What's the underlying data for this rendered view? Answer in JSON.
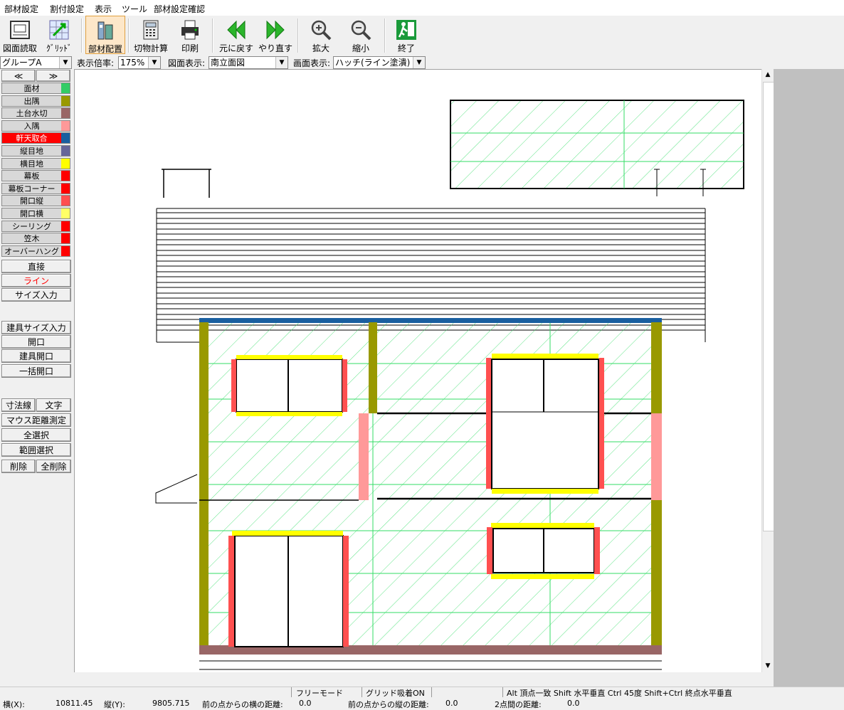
{
  "menu": [
    "部材設定",
    "割付設定",
    "表示",
    "ツール",
    "部材設定確認"
  ],
  "toolbar": [
    {
      "label": "図面読取",
      "icon": "drawing-scan-icon"
    },
    {
      "label": "ｸﾞﾘｯﾄﾞ",
      "icon": "grid-icon"
    },
    {
      "label": "部材配置",
      "icon": "material-place-icon"
    },
    {
      "label": "切物計算",
      "icon": "cut-calc-icon"
    },
    {
      "label": "印刷",
      "icon": "printer-icon"
    },
    {
      "label": "元に戻す",
      "icon": "undo-arrow-icon"
    },
    {
      "label": "やり直す",
      "icon": "redo-arrow-icon"
    },
    {
      "label": "拡大",
      "icon": "zoom-in-icon"
    },
    {
      "label": "縮小",
      "icon": "zoom-out-icon"
    },
    {
      "label": "終了",
      "icon": "exit-icon"
    }
  ],
  "group_select": "グループA",
  "zoom": {
    "label": "表示倍率:",
    "value": "175%"
  },
  "view": {
    "label": "図面表示:",
    "value": "南立面図"
  },
  "display": {
    "label": "画面表示:",
    "value": "ハッチ(ライン塗潰)"
  },
  "nav": {
    "prev": "≪",
    "next": "≫"
  },
  "materials": [
    {
      "label": "面材",
      "color": "#33cc66"
    },
    {
      "label": "出隅",
      "color": "#999900"
    },
    {
      "label": "土台水切",
      "color": "#996666"
    },
    {
      "label": "入隅",
      "color": "#ff9999"
    },
    {
      "label": "軒天取合",
      "color": "#1a5fa0",
      "selected": true
    },
    {
      "label": "縦目地",
      "color": "#666699"
    },
    {
      "label": "横目地",
      "color": "#ffff00"
    },
    {
      "label": "幕板",
      "color": "#ff0000"
    },
    {
      "label": "幕板コーナー",
      "color": "#ff0000"
    },
    {
      "label": "開口縦",
      "color": "#ff5050"
    },
    {
      "label": "開口横",
      "color": "#ffff66"
    },
    {
      "label": "シーリング",
      "color": "#ff0000"
    },
    {
      "label": "笠木",
      "color": "#ff0000"
    },
    {
      "label": "オーバーハング",
      "color": "#ff0000"
    }
  ],
  "mode_buttons": [
    "直接",
    "ライン",
    "サイズ入力"
  ],
  "opening_buttons": [
    "建具サイズ入力",
    "開口",
    "建具開口",
    "一括開口"
  ],
  "tool_buttons": {
    "dim": "寸法線",
    "text": "文字",
    "measure": "マウス距離測定",
    "select_all": "全選択",
    "range": "範囲選択",
    "delete": "削除",
    "delete_all": "全削除"
  },
  "status": {
    "mode": "フリーモード",
    "grid": "グリッド吸着ON",
    "hint": "Alt 頂点一致  Shift 水平垂直  Ctrl 45度  Shift+Ctrl 終点水平垂直",
    "x_label": "横(X):",
    "x_value": "10811.45",
    "y_label": "縦(Y):",
    "y_value": "9805.715",
    "dx_label": "前の点からの横の距離:",
    "dx_value": "0.0",
    "dy_label": "前の点からの縦の距離:",
    "dy_value": "0.0",
    "d_label": "2点間の距離:",
    "d_value": "0.0"
  }
}
